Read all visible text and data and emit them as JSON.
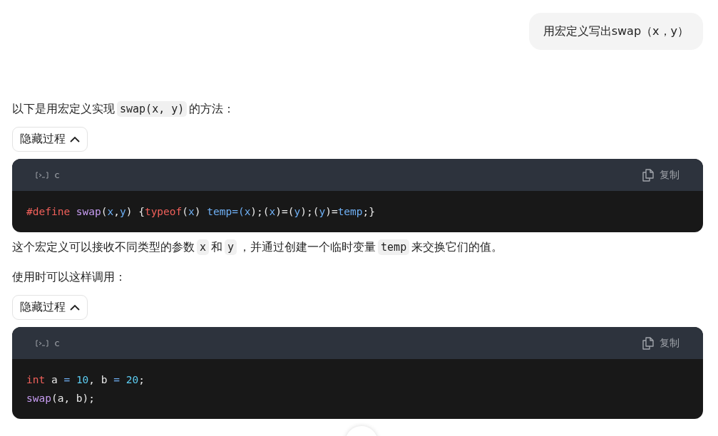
{
  "user_message": {
    "text": "用宏定义写出swap（x，y）"
  },
  "answer": [
    {
      "kind": "paragraph",
      "parts": [
        {
          "kind": "text",
          "text": "以下是用宏定义实现"
        },
        {
          "kind": "code",
          "text": "swap(x, y)"
        },
        {
          "kind": "text",
          "text": "的方法："
        }
      ]
    },
    {
      "kind": "toggle",
      "label": "隐藏过程",
      "expanded": true
    },
    {
      "kind": "codeblock",
      "language": "c",
      "copy_label": "复制",
      "lines": [
        [
          {
            "kind": "keyword",
            "text": "#define"
          },
          {
            "kind": "function",
            "text": " swap"
          },
          {
            "kind": "plain",
            "text": "("
          },
          {
            "kind": "variable",
            "text": "x"
          },
          {
            "kind": "plain",
            "text": ","
          },
          {
            "kind": "variable",
            "text": "y"
          },
          {
            "kind": "plain",
            "text": ") {"
          },
          {
            "kind": "keyword",
            "text": "typeof"
          },
          {
            "kind": "plain",
            "text": "("
          },
          {
            "kind": "variable",
            "text": "x"
          },
          {
            "kind": "plain",
            "text": ") "
          },
          {
            "kind": "variable",
            "text": "temp=("
          },
          {
            "kind": "variable",
            "text": "x"
          },
          {
            "kind": "plain",
            "text": ");("
          },
          {
            "kind": "variable",
            "text": "x"
          },
          {
            "kind": "plain",
            "text": ")=("
          },
          {
            "kind": "variable",
            "text": "y"
          },
          {
            "kind": "plain",
            "text": ");("
          },
          {
            "kind": "variable",
            "text": "y"
          },
          {
            "kind": "plain",
            "text": ")="
          },
          {
            "kind": "variable",
            "text": "temp"
          },
          {
            "kind": "plain",
            "text": ";}"
          }
        ]
      ]
    },
    {
      "kind": "paragraph",
      "parts": [
        {
          "kind": "text",
          "text": "这个宏定义可以接收不同类型的参数"
        },
        {
          "kind": "code",
          "text": "x"
        },
        {
          "kind": "text",
          "text": "和"
        },
        {
          "kind": "code",
          "text": "y"
        },
        {
          "kind": "text",
          "text": "，并通过创建一个临时变量"
        },
        {
          "kind": "code",
          "text": "temp"
        },
        {
          "kind": "text",
          "text": "来交换它们的值。"
        }
      ]
    },
    {
      "kind": "paragraph",
      "parts": [
        {
          "kind": "text",
          "text": "使用时可以这样调用："
        }
      ]
    },
    {
      "kind": "toggle",
      "label": "隐藏过程",
      "expanded": true
    },
    {
      "kind": "codeblock",
      "language": "c",
      "copy_label": "复制",
      "lines": [
        [
          {
            "kind": "keyword",
            "text": "int"
          },
          {
            "kind": "plain",
            "text": " a "
          },
          {
            "kind": "variable",
            "text": "= "
          },
          {
            "kind": "number",
            "text": "10"
          },
          {
            "kind": "plain",
            "text": ", b "
          },
          {
            "kind": "variable",
            "text": "= "
          },
          {
            "kind": "number",
            "text": "20"
          },
          {
            "kind": "plain",
            "text": ";"
          }
        ],
        [
          {
            "kind": "function",
            "text": "swap"
          },
          {
            "kind": "plain",
            "text": "(a, b);"
          }
        ]
      ]
    }
  ]
}
